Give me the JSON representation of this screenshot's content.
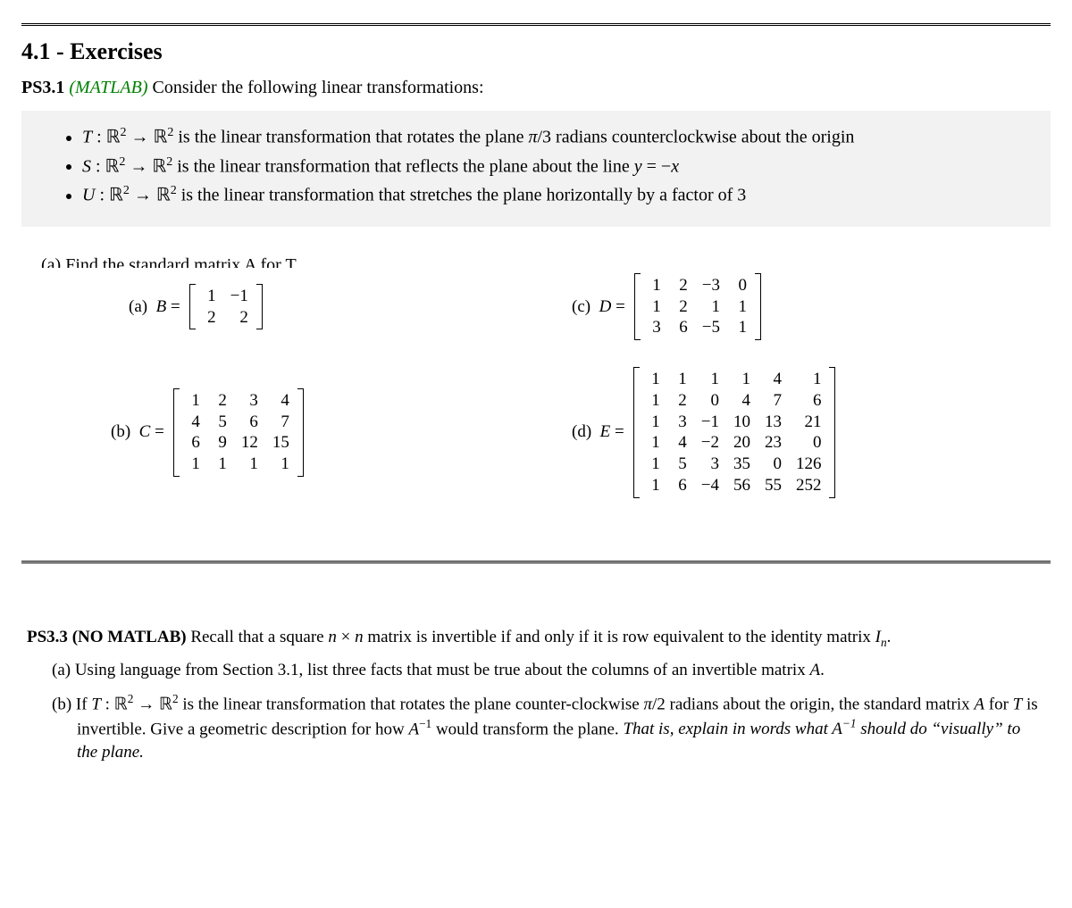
{
  "section_title": "4.1 - Exercises",
  "ps31": {
    "label": "PS3.1",
    "tag": "(MATLAB)",
    "intro": "Consider the following linear transformations:",
    "items": {
      "t": "T : ℝ² → ℝ² is the linear transformation that rotates the plane π/3 radians counterclockwise about the origin",
      "s": "S : ℝ² → ℝ² is the linear transformation that reflects the plane about the line y = −x",
      "u": "U : ℝ² → ℝ² is the linear transformation that stretches the plane horizontally by a factor of 3"
    },
    "partial": "(a) Find the standard matrix A for T",
    "matrices": {
      "a": {
        "label": "(a)  B =",
        "rows": [
          [
            "1",
            "−1"
          ],
          [
            "2",
            "2"
          ]
        ]
      },
      "b": {
        "label": "(b)  C =",
        "rows": [
          [
            "1",
            "2",
            "3",
            "4"
          ],
          [
            "4",
            "5",
            "6",
            "7"
          ],
          [
            "6",
            "9",
            "12",
            "15"
          ],
          [
            "1",
            "1",
            "1",
            "1"
          ]
        ]
      },
      "c": {
        "label": "(c)  D =",
        "rows": [
          [
            "1",
            "2",
            "−3",
            "0"
          ],
          [
            "1",
            "2",
            "1",
            "1"
          ],
          [
            "3",
            "6",
            "−5",
            "1"
          ]
        ]
      },
      "d": {
        "label": "(d)  E =",
        "rows": [
          [
            "1",
            "1",
            "1",
            "1",
            "4",
            "1"
          ],
          [
            "1",
            "2",
            "0",
            "4",
            "7",
            "6"
          ],
          [
            "1",
            "3",
            "−1",
            "10",
            "13",
            "21"
          ],
          [
            "1",
            "4",
            "−2",
            "20",
            "23",
            "0"
          ],
          [
            "1",
            "5",
            "3",
            "35",
            "0",
            "126"
          ],
          [
            "1",
            "6",
            "−4",
            "56",
            "55",
            "252"
          ]
        ]
      }
    }
  },
  "ps33": {
    "label": "PS3.3",
    "tag": "(NO MATLAB)",
    "intro_a": "Recall that a square n × n matrix is invertible if and only if it is row equivalent to the identity matrix Iₙ.",
    "a": "(a) Using language from Section 3.1, list three facts that must be true about the columns of an invertible matrix A.",
    "b_pre": "(b) If T : ℝ² → ℝ² is the linear transformation that rotates the plane counter-clockwise π/2 radians about the origin, the standard matrix A for T is invertible. Give a geometric description for how A⁻¹ would transform the plane. ",
    "b_ital": "That is, explain in words what A⁻¹ should do “visually” to the plane."
  }
}
